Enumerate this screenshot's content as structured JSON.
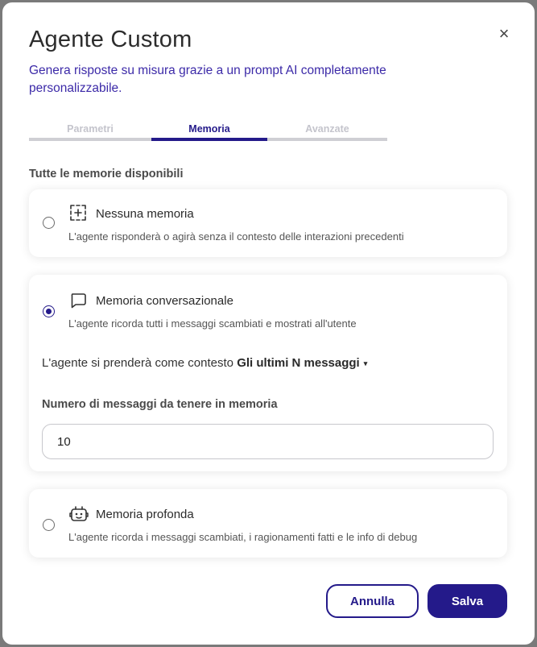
{
  "dialog": {
    "title": "Agente Custom",
    "subtitle": "Genera risposte su misura grazie a un prompt AI completamente personalizzabile.",
    "close_icon": "close-icon",
    "close_symbol": "×"
  },
  "tabs": [
    {
      "label": "Parametri",
      "active": false
    },
    {
      "label": "Memoria",
      "active": true
    },
    {
      "label": "Avanzate",
      "active": false
    }
  ],
  "memory": {
    "section_label": "Tutte le memorie disponibili",
    "options": [
      {
        "icon": "dashed-plus-icon",
        "title": "Nessuna memoria",
        "description": "L'agente risponderà o agirà senza il contesto delle interazioni precedenti",
        "selected": false
      },
      {
        "icon": "chat-bubble-icon",
        "title": "Memoria conversazionale",
        "description": "L'agente ricorda tutti i messaggi scambiati e mostrati all'utente",
        "selected": true
      },
      {
        "icon": "robot-icon",
        "title": "Memoria profonda",
        "description": "L'agente ricorda i messaggi scambiati, i ragionamenti fatti e le info di debug",
        "selected": false
      }
    ],
    "context_prefix": "L'agente si prenderà come contesto",
    "context_value": "Gli ultimi N messaggi",
    "context_caret": "▾",
    "count_label": "Numero di messaggi da tenere in memoria",
    "count_value": "10"
  },
  "footer": {
    "cancel_label": "Annulla",
    "save_label": "Salva"
  },
  "colors": {
    "accent": "#241a8a",
    "subtitle": "#3c2aa8",
    "tab_inactive": "#c4c4cc"
  }
}
